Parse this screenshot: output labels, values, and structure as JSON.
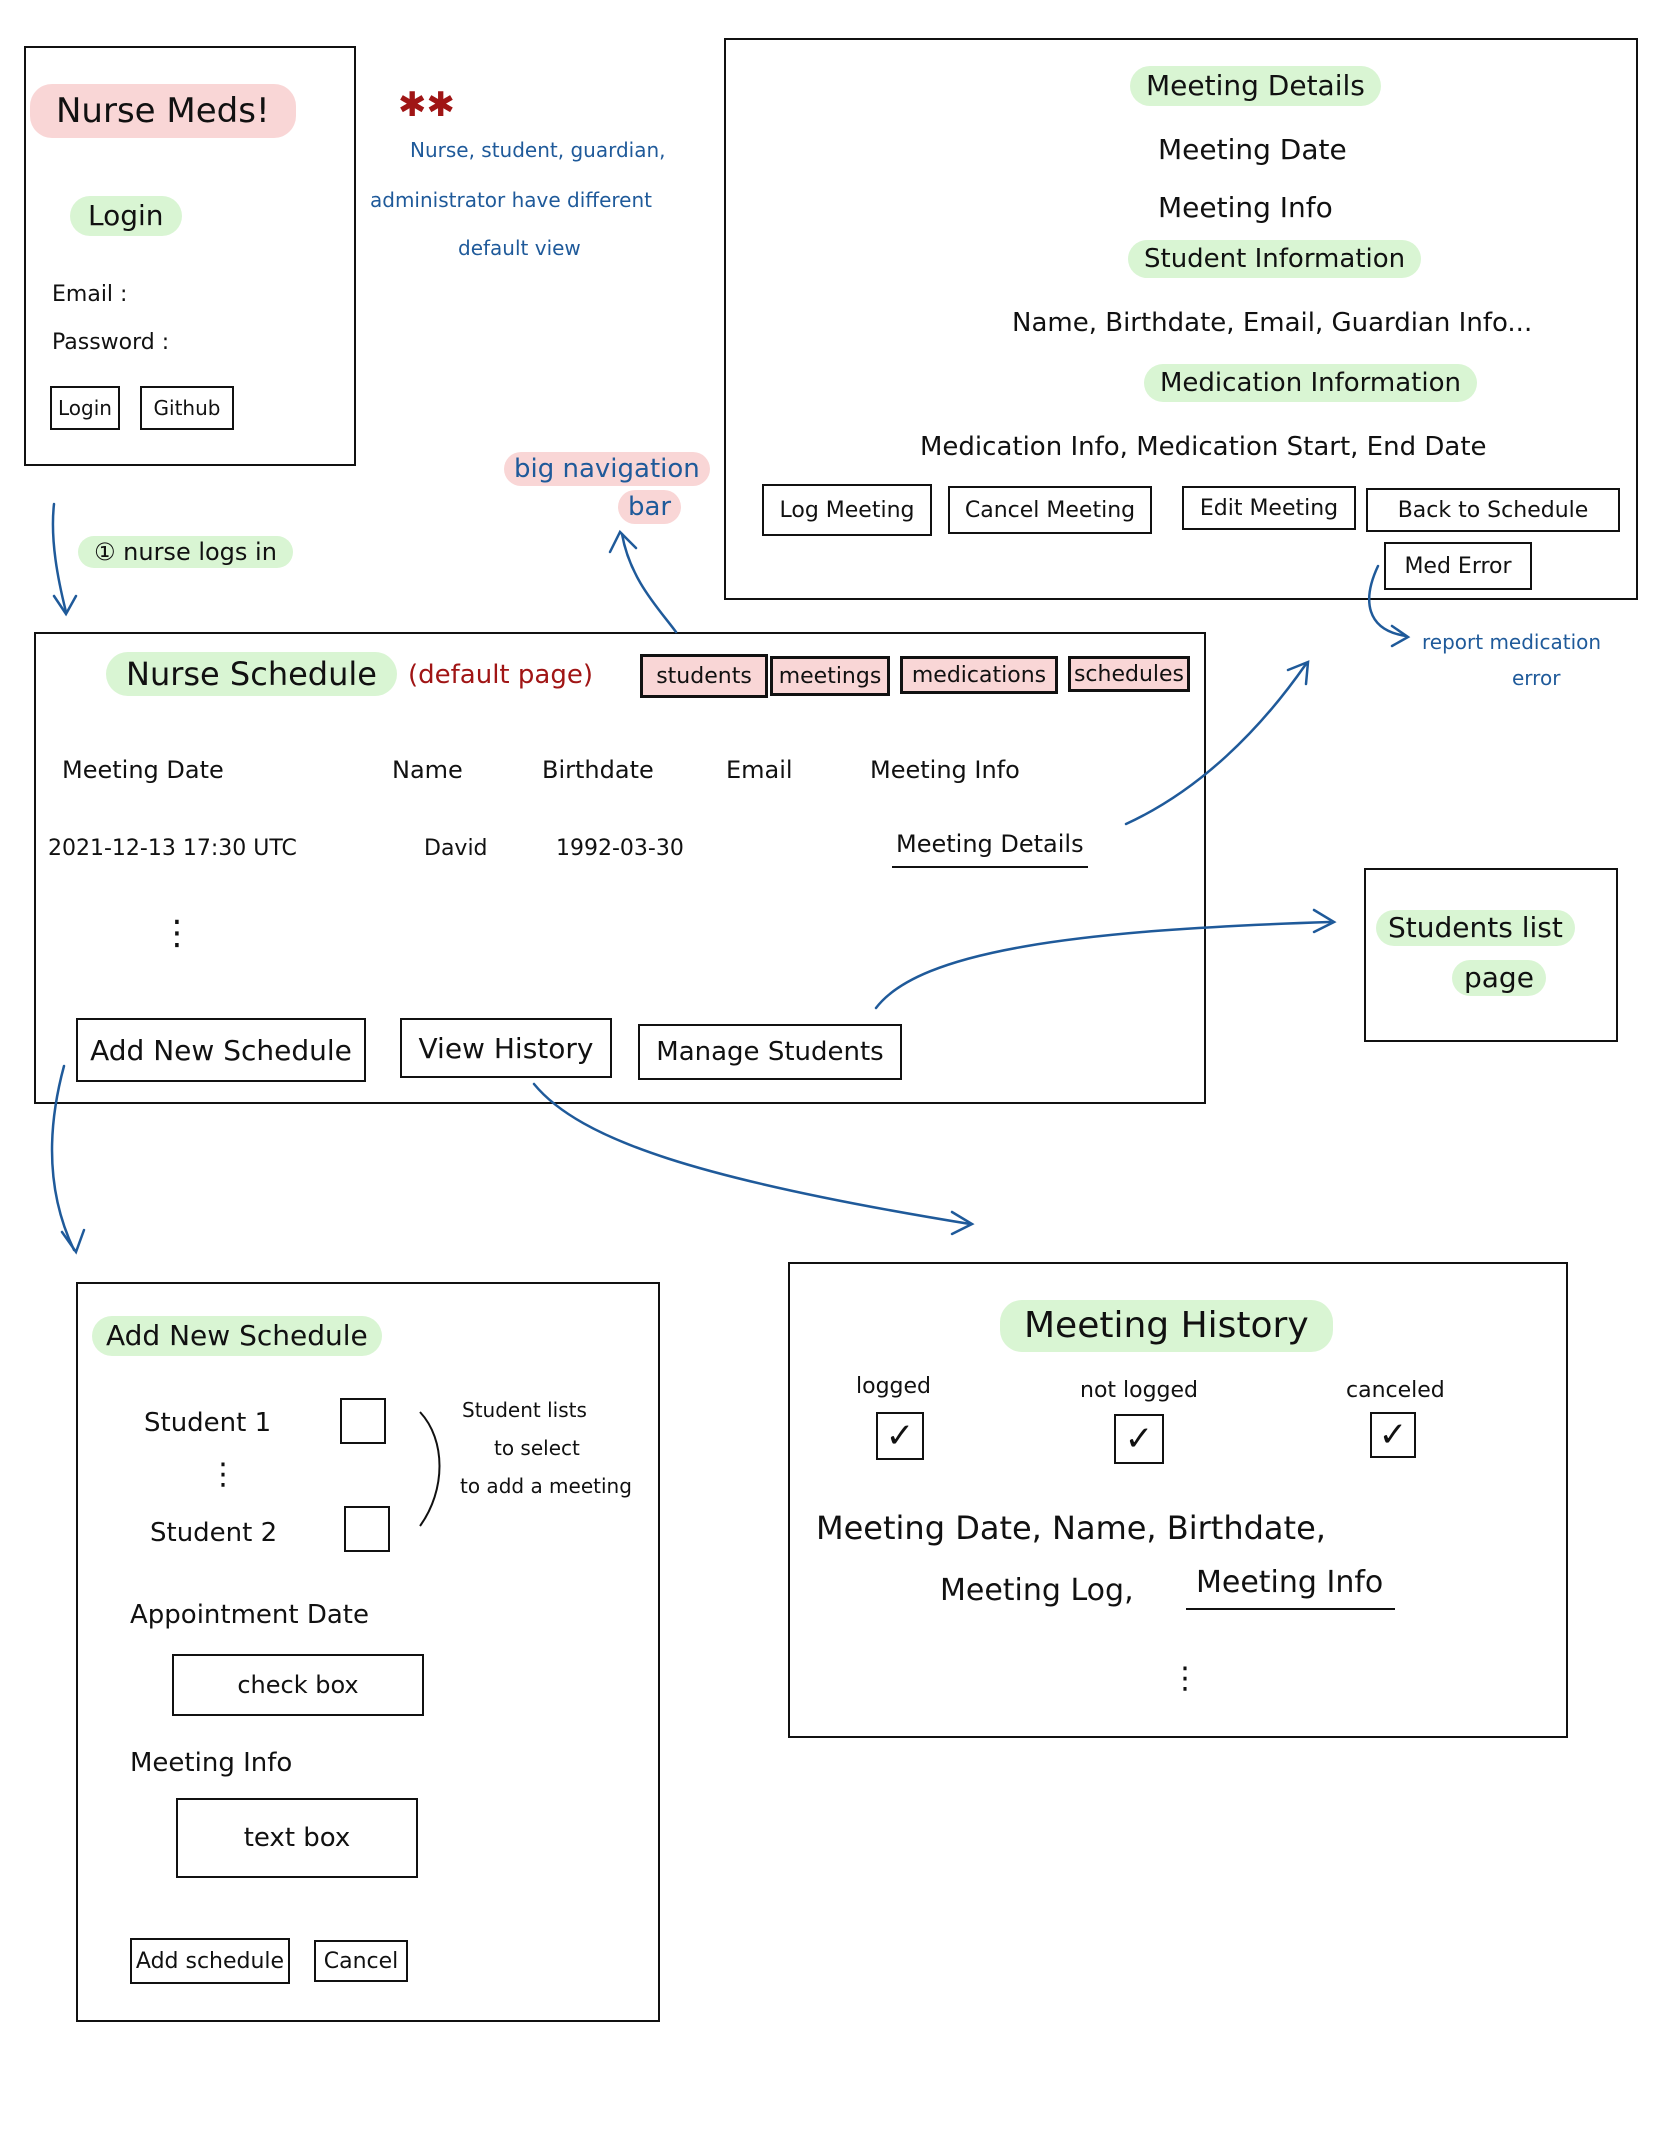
{
  "login": {
    "title": "Nurse Meds!",
    "heading": "Login",
    "email_label": "Email :",
    "password_label": "Password :",
    "login_button": "Login",
    "github_button": "Github"
  },
  "annotations": {
    "roles_note": [
      "Nurse, student, guardian,",
      "administrator have different",
      "default view"
    ],
    "step1": "① nurse logs in",
    "big_nav": [
      "big navigation",
      "bar"
    ],
    "report_error": [
      "report medication",
      "error"
    ],
    "student_lists": [
      "Student lists",
      "to select",
      "to add a meeting"
    ]
  },
  "meeting_details": {
    "title": "Meeting Details",
    "meeting_date": "Meeting Date",
    "meeting_info": "Meeting Info",
    "student_info_heading": "Student Information",
    "student_info": "Name, Birthdate, Email, Guardian Info...",
    "medication_heading": "Medication Information",
    "medication_info": "Medication Info, Medication Start, End Date",
    "buttons": [
      "Log Meeting",
      "Cancel Meeting",
      "Edit Meeting",
      "Back to Schedule"
    ],
    "med_error_button": "Med Error"
  },
  "schedule": {
    "title": "Nurse Schedule",
    "default_note": "(default page)",
    "nav": [
      "students",
      "meetings",
      "medications",
      "schedules"
    ],
    "columns": [
      "Meeting Date",
      "Name",
      "Birthdate",
      "Email",
      "Meeting Info"
    ],
    "row": {
      "date": "2021-12-13 17:30 UTC",
      "name": "David",
      "birthdate": "1992-03-30",
      "email": "",
      "info_link": "Meeting Details"
    },
    "ellipsis": "⋮",
    "buttons": [
      "Add New Schedule",
      "View History",
      "Manage Students"
    ]
  },
  "students_list": {
    "line1": "Students list",
    "line2": "page"
  },
  "add_schedule": {
    "title": "Add New Schedule",
    "student1": "Student 1",
    "student2": "Student 2",
    "ellipsis": "⋮",
    "appointment_label": "Appointment Date",
    "appointment_box": "check box",
    "info_label": "Meeting Info",
    "info_box": "text box",
    "add_button": "Add schedule",
    "cancel_button": "Cancel"
  },
  "history": {
    "title": "Meeting History",
    "filters": [
      {
        "label": "logged",
        "mark": "✓"
      },
      {
        "label": "not logged",
        "mark": "✓"
      },
      {
        "label": "canceled",
        "mark": "✓"
      }
    ],
    "fields_line1": "Meeting Date, Name, Birthdate,",
    "fields_line2": "Meeting Log,",
    "fields_link": "Meeting Info",
    "ellipsis": "⋮"
  },
  "colors": {
    "highlight_green": "#d9f5d3",
    "highlight_pink": "#f9d6d6",
    "annotation_blue": "#1f5a9a",
    "annotation_red": "#a01515"
  }
}
